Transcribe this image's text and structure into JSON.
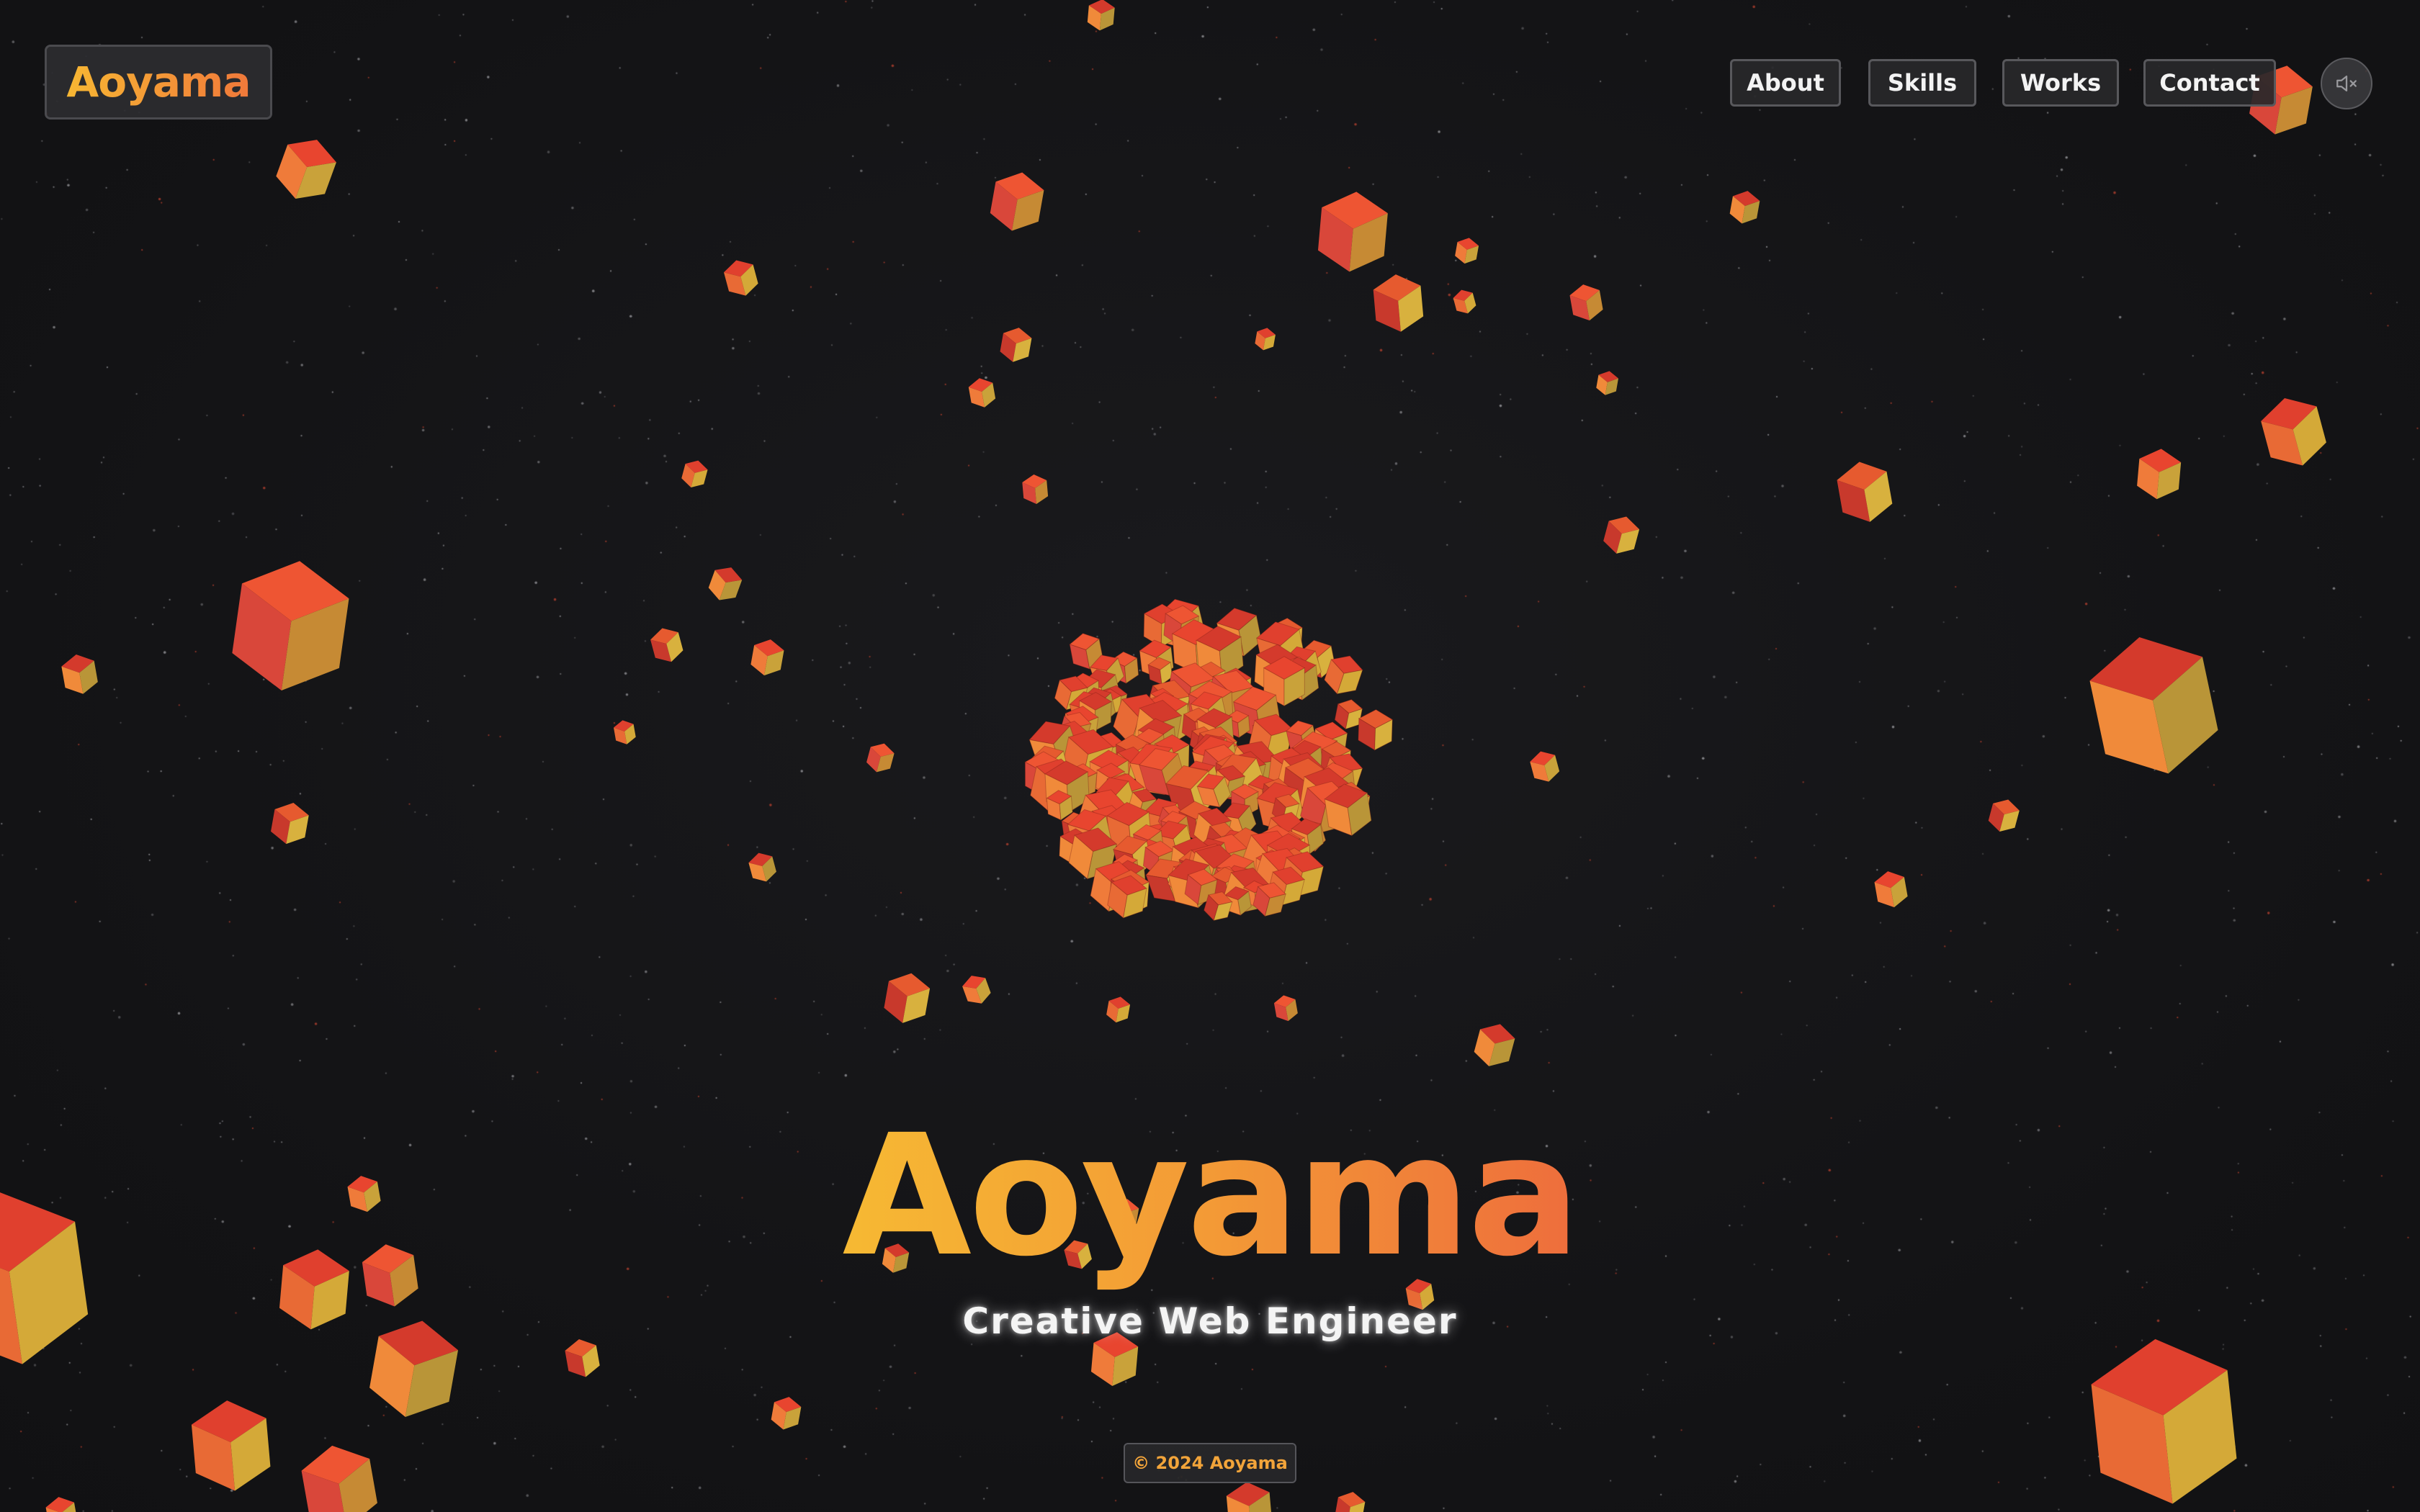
{
  "header": {
    "logo_text": "Aoyama",
    "nav": [
      {
        "label": "About"
      },
      {
        "label": "Skills"
      },
      {
        "label": "Works"
      },
      {
        "label": "Contact"
      }
    ],
    "sound_toggle_icon": "speaker-muted-icon"
  },
  "hero": {
    "title": "Aoyama",
    "subtitle": "Creative Web Engineer"
  },
  "footer": {
    "copyright": "© 2024 Aoyama"
  },
  "colors": {
    "background": "#131315",
    "accent_start": "#f7b733",
    "accent_end": "#f0783a",
    "cube_red": "#e0402e",
    "cube_yellow": "#d8a838"
  },
  "scene": {
    "description_icon": "floating-cubes-3d-scene"
  }
}
